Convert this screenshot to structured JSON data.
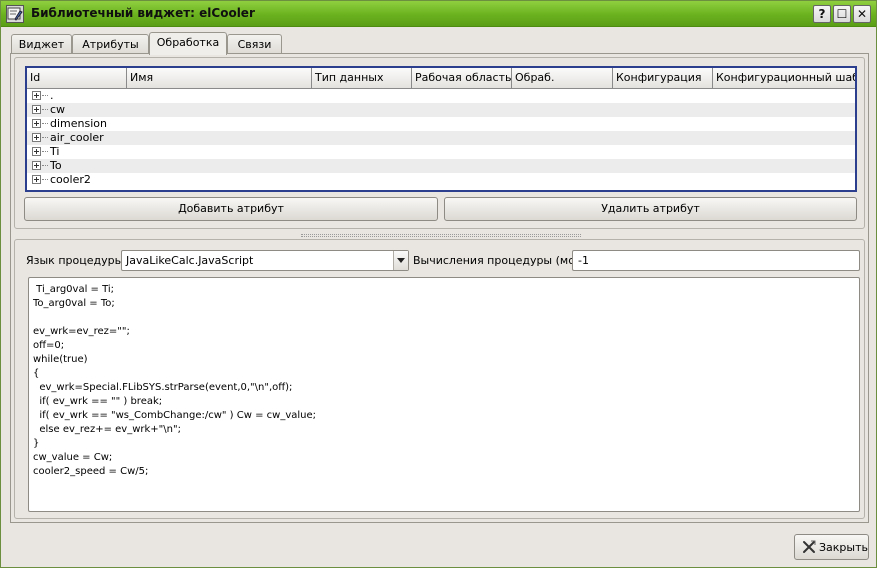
{
  "window": {
    "title": "Библиотечный виджет: elCooler",
    "help_label": "?",
    "maximize_label": "☐",
    "close_label": "✕"
  },
  "tabs": [
    {
      "label": "Виджет"
    },
    {
      "label": "Атрибуты"
    },
    {
      "label": "Обработка"
    },
    {
      "label": "Связи"
    }
  ],
  "active_tab": "Обработка",
  "attributes_table": {
    "headers": [
      "Id",
      "Имя",
      "Тип данных",
      "Рабочая область",
      "Обраб.",
      "Конфигурация",
      "Конфигурационный шаблон"
    ],
    "rows": [
      ".",
      "cw",
      "dimension",
      "air_cooler",
      "Ti",
      "To",
      "cooler2"
    ]
  },
  "buttons": {
    "add_attribute": "Добавить атрибут",
    "delete_attribute": "Удалить атрибут",
    "close": "Закрыть"
  },
  "procedure": {
    "language_label": "Язык процедуры:",
    "language_value": "JavaLikeCalc.JavaScript",
    "calc_period_label": "Вычисления процедуры (мс):",
    "calc_period_value": "-1",
    "code": " Ti_arg0val = Ti;\nTo_arg0val = To;\n\nev_wrk=ev_rez=\"\";\noff=0;\nwhile(true)\n{\n  ev_wrk=Special.FLibSYS.strParse(event,0,\"\\n\",off);\n  if( ev_wrk == \"\" ) break;\n  if( ev_wrk == \"ws_CombChange:/cw\" ) Cw = cw_value;\n  else ev_rez+= ev_wrk+\"\\n\";\n}\ncw_value = Cw;\ncooler2_speed = Cw/5;"
  },
  "colors": {
    "titlebar": "#6bb21f",
    "table_border": "#2c3f8f",
    "window_bg": "#e9e6e1"
  },
  "icons": {
    "window": "widget-edit-icon",
    "close_button": "close-x-icon",
    "tree_expander": "plus-box-icon"
  }
}
